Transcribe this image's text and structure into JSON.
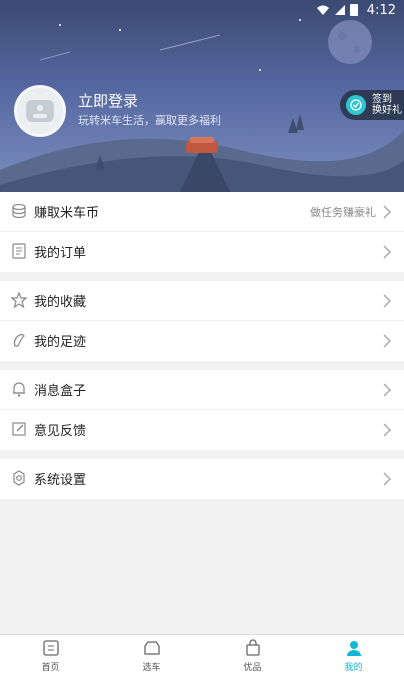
{
  "status_bar": {
    "time": "4:12"
  },
  "profile": {
    "login_title": "立即登录",
    "login_subtitle": "玩转米车生活，赢取更多福利",
    "signin_line1": "签到",
    "signin_line2": "换好礼"
  },
  "menu": {
    "groups": [
      [
        {
          "label": "赚取米车币",
          "hint": "做任务赚豪礼",
          "icon": "coins-icon"
        },
        {
          "label": "我的订单",
          "hint": "",
          "icon": "order-icon"
        }
      ],
      [
        {
          "label": "我的收藏",
          "hint": "",
          "icon": "star-icon"
        },
        {
          "label": "我的足迹",
          "hint": "",
          "icon": "footprint-icon"
        }
      ],
      [
        {
          "label": "消息盒子",
          "hint": "",
          "icon": "bell-icon"
        },
        {
          "label": "意见反馈",
          "hint": "",
          "icon": "edit-icon"
        }
      ],
      [
        {
          "label": "系统设置",
          "hint": "",
          "icon": "gear-icon"
        }
      ]
    ]
  },
  "tabbar": {
    "items": [
      {
        "label": "首页",
        "icon": "home-icon"
      },
      {
        "label": "选车",
        "icon": "car-icon"
      },
      {
        "label": "优品",
        "icon": "bag-icon"
      },
      {
        "label": "我的",
        "icon": "user-icon"
      }
    ],
    "active_index": 3
  },
  "colors": {
    "accent": "#12b7d6",
    "hero_top": "#3b4a72",
    "hero_bottom": "#7c8fbf"
  }
}
